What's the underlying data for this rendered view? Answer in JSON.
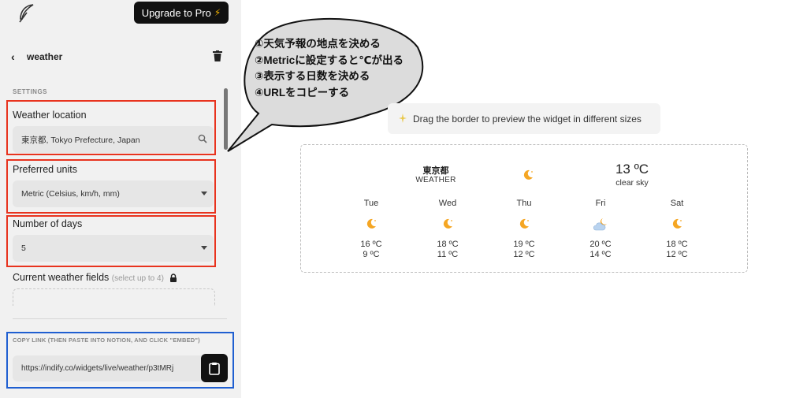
{
  "header": {
    "upgrade_label": "Upgrade to Pro",
    "upgrade_icon": "⚡"
  },
  "page": {
    "back_icon": "‹",
    "title": "weather"
  },
  "settings": {
    "section_label": "SETTINGS",
    "location": {
      "label": "Weather location",
      "value": "東京都, Tokyo Prefecture, Japan"
    },
    "units": {
      "label": "Preferred units",
      "value": "Metric (Celsius, km/h, mm)"
    },
    "days": {
      "label": "Number of days",
      "value": "5"
    },
    "fields": {
      "label": "Current weather fields",
      "hint": "(select up to 4)"
    }
  },
  "copy": {
    "label": "COPY LINK (THEN PASTE INTO NOTION, AND CLICK \"EMBED\")",
    "url": "https://indify.co/widgets/live/weather/p3tMRj"
  },
  "annotation": {
    "lines": [
      "①天気予報の地点を決める",
      "②Metricに設定すると℃が出る",
      "③表示する日数を決める",
      "④URLをコピーする"
    ]
  },
  "preview_hint": "Drag the border to preview the widget in different sizes",
  "widget": {
    "city": "東京都",
    "label": "WEATHER",
    "temp": "13 ºC",
    "condition": "clear sky",
    "forecast": [
      {
        "day": "Tue",
        "icon": "moon-icon",
        "high": "16 ºC",
        "low": "9 ºC"
      },
      {
        "day": "Wed",
        "icon": "moon-icon",
        "high": "18 ºC",
        "low": "11 ºC"
      },
      {
        "day": "Thu",
        "icon": "moon-icon",
        "high": "19 ºC",
        "low": "12 ºC"
      },
      {
        "day": "Fri",
        "icon": "partly-cloudy-icon",
        "high": "20 ºC",
        "low": "14 ºC"
      },
      {
        "day": "Sat",
        "icon": "moon-icon",
        "high": "18 ºC",
        "low": "12 ºC"
      }
    ]
  },
  "colors": {
    "highlight_red": "#e8331e",
    "highlight_blue": "#1f5fd1",
    "moon": "#f5a623"
  }
}
